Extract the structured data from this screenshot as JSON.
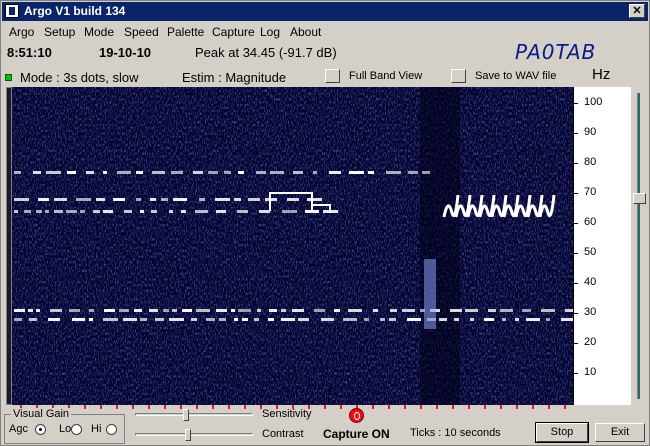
{
  "app": {
    "title": "Argo V1 build 134",
    "close_glyph": "✕"
  },
  "menu": [
    "Argo",
    "Setup",
    "Mode",
    "Speed",
    "Palette",
    "Capture",
    "Log",
    "About"
  ],
  "info": {
    "time": "8:51:10",
    "date": "19-10-10",
    "peak": "Peak at  34.45 (-91.7 dB)",
    "callsign": "PA0TAB"
  },
  "mode": {
    "mode_text": "Mode : 3s dots, slow",
    "estim_text": "Estim : Magnitude",
    "full_band_label": "Full Band View",
    "save_wav_label": "Save to WAV file",
    "unit": "Hz"
  },
  "scale": {
    "ticks": [
      "100",
      "90",
      "80",
      "70",
      "60",
      "50",
      "40",
      "30",
      "20",
      "10"
    ]
  },
  "spectrogram": {
    "background": "#000030",
    "signal_color": "#ffffff",
    "noise_color": "#3a4aa0",
    "time_marker_color": "#e02020",
    "traces_hz": [
      77,
      68,
      64,
      31,
      28
    ]
  },
  "controls": {
    "visual_gain_label": "Visual Gain",
    "agc_label": "Agc",
    "lo_label": "Lo",
    "hi_label": "Hi",
    "selected_gain": "Agc",
    "sensitivity_label": "Sensitivity",
    "contrast_label": "Contrast",
    "capture_status": "Capture ON",
    "ticks_label": "Ticks  : 10 seconds",
    "stop_label": "Stop",
    "exit_label": "Exit"
  }
}
